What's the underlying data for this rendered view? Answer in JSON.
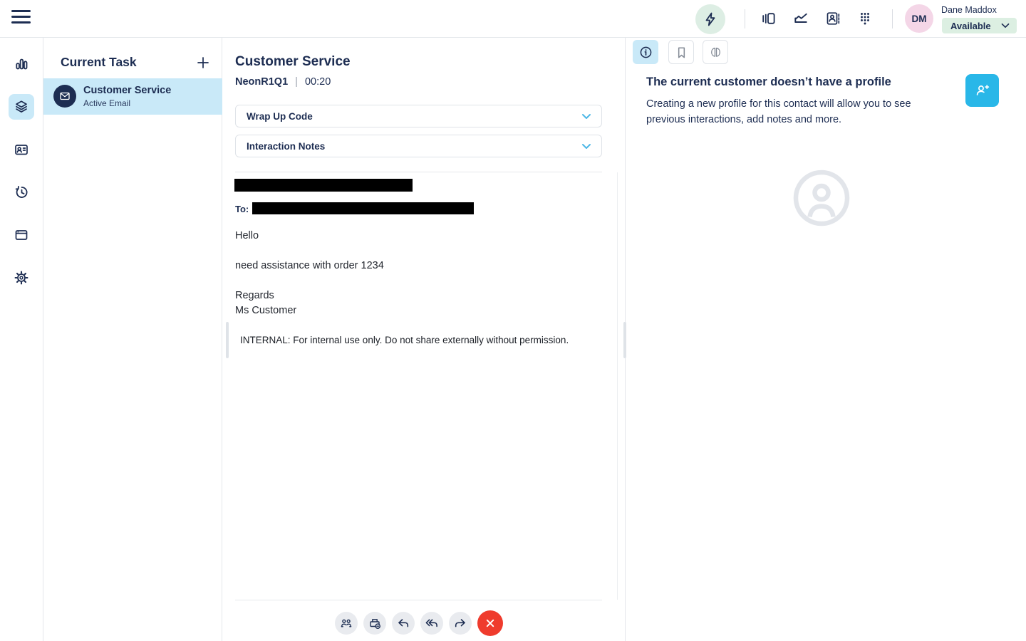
{
  "header": {
    "user_initials": "DM",
    "user_name": "Dane Maddox",
    "status": "Available"
  },
  "task_panel": {
    "title": "Current Task",
    "task_title": "Customer Service",
    "task_subtitle": "Active Email"
  },
  "interaction": {
    "title": "Customer Service",
    "queue": "NeonR1Q1",
    "separator": "|",
    "timer": "00:20",
    "wrap_up_label": "Wrap Up Code",
    "notes_label": "Interaction Notes",
    "email": {
      "to_label": "To:",
      "line_greeting": "Hello",
      "line_body": "need assistance with order 1234",
      "line_signoff": "Regards",
      "line_signature": "Ms Customer",
      "internal_note": "INTERNAL: For internal use only. Do not share externally without permission."
    }
  },
  "profile_panel": {
    "heading": "The current customer doesn’t have a profile",
    "description": "Creating a new profile for this contact will allow you to see previous interactions, add notes and more."
  },
  "colors": {
    "navy": "#1d2d52",
    "accent_cyan": "#29b7e8",
    "highlight_blue": "#c9e9f8",
    "status_green": "#dcefe2",
    "avatar_pink": "#f4d6e7",
    "danger_red": "#ef3b2d"
  }
}
